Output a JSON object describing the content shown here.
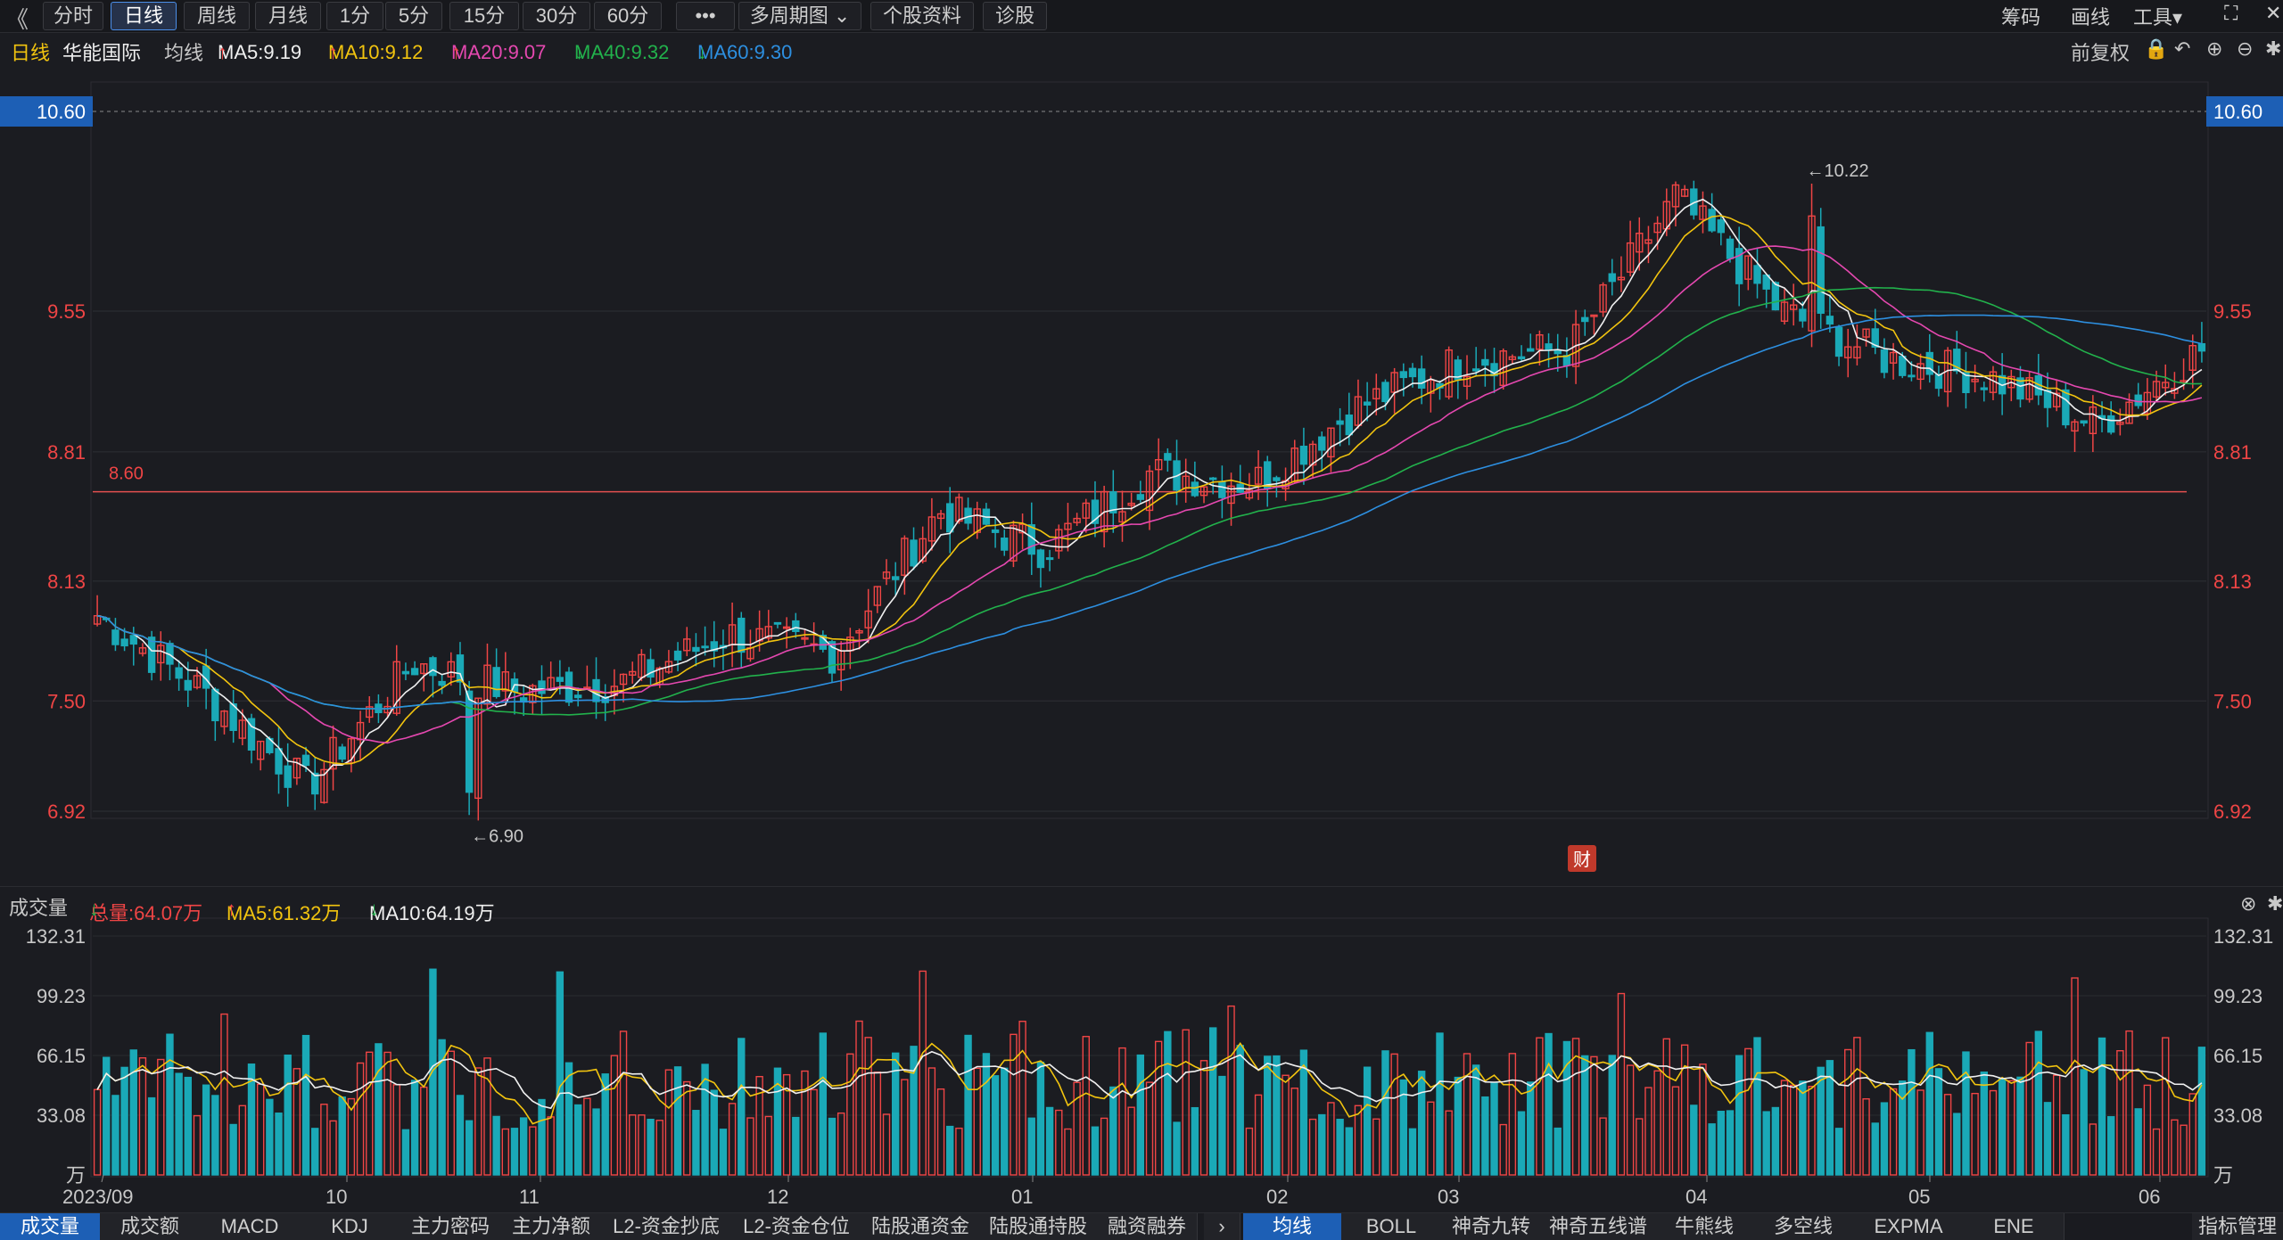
{
  "toolbar": {
    "back_icon": "double-chevron-left-icon",
    "periods": [
      "分时",
      "日线",
      "周线",
      "月线",
      "1分",
      "5分",
      "15分",
      "30分",
      "60分"
    ],
    "active_period": "日线",
    "more_label": "•••",
    "multi_period_label": "多周期图",
    "stock_info_label": "个股资料",
    "diagnose_label": "诊股",
    "chips_label": "筹码",
    "draw_label": "画线",
    "tools_label": "工具"
  },
  "info": {
    "chart_type": "日线",
    "stock_name": "华能国际",
    "ma_label": "均线",
    "ma5": "MA5:9.19",
    "ma10": "MA10:9.12",
    "ma20": "MA20:9.07",
    "ma40": "MA40:9.32",
    "ma60": "MA60:9.30",
    "adjust_label": "前复权"
  },
  "colors": {
    "up": "#ef4545",
    "down": "#1aa9b7",
    "ma5": "#f0f0f0",
    "ma10": "#f2c40f",
    "ma20": "#e548b0",
    "ma40": "#22b24c",
    "ma60": "#2d8fe0",
    "accent": "#1d5fb5"
  },
  "price_axis": {
    "ticks": [
      "10.60",
      "9.55",
      "8.81",
      "8.13",
      "7.50",
      "6.92"
    ],
    "current": "10.60"
  },
  "annotations": {
    "high": "←10.22",
    "low": "←6.90",
    "hline": "8.60",
    "finance_badge": "财"
  },
  "volume": {
    "label": "成交量",
    "total": "总量:64.07万",
    "ma5": "MA5:61.32万",
    "ma10": "MA10:64.19万",
    "axis_ticks": [
      "132.31",
      "99.23",
      "66.15",
      "33.08",
      "万"
    ]
  },
  "date_axis": [
    "2023/09",
    "10",
    "11",
    "12",
    "01",
    "02",
    "03",
    "04",
    "05",
    "06"
  ],
  "indicator_tabs_left": [
    "成交量",
    "成交额",
    "MACD",
    "KDJ",
    "主力密码",
    "主力净额",
    "L2-资金抄底",
    "L2-资金仓位",
    "陆股通资金",
    "陆股通持股",
    "融资融券"
  ],
  "indicator_tabs_right": [
    "均线",
    "BOLL",
    "神奇九转",
    "神奇五线谱",
    "牛熊线",
    "多空线",
    "EXPMA",
    "ENE"
  ],
  "indicator_manage_label": "指标管理",
  "chart_data": {
    "type": "candlestick",
    "title": "",
    "y_range": [
      6.92,
      10.6
    ],
    "volume_range": [
      0,
      132.31
    ],
    "x_labels": [
      "2023/09",
      "10",
      "11",
      "12",
      "01",
      "02",
      "03",
      "04",
      "05",
      "06"
    ],
    "close_anchors": [
      [
        "2023/09",
        7.95
      ],
      [
        "10",
        7.55
      ],
      [
        "10-late",
        7.05
      ],
      [
        "11",
        7.7
      ],
      [
        "11-mid",
        7.55
      ],
      [
        "12",
        7.6
      ],
      [
        "12-mid",
        7.85
      ],
      [
        "01",
        7.75
      ],
      [
        "01-mid",
        8.5
      ],
      [
        "01-late",
        8.3
      ],
      [
        "02",
        8.7
      ],
      [
        "02-mid",
        8.65
      ],
      [
        "03",
        9.05
      ],
      [
        "03-late",
        9.3
      ],
      [
        "04",
        9.35
      ],
      [
        "04-mid",
        10.15
      ],
      [
        "04-late",
        9.55
      ],
      [
        "05",
        9.3
      ],
      [
        "05-mid",
        9.2
      ],
      [
        "06",
        8.95
      ],
      [
        "06-late",
        9.35
      ]
    ],
    "ma_series": [
      "MA5",
      "MA10",
      "MA20",
      "MA40",
      "MA60"
    ],
    "high": 10.22,
    "low": 6.9,
    "reference_line": 8.6
  }
}
